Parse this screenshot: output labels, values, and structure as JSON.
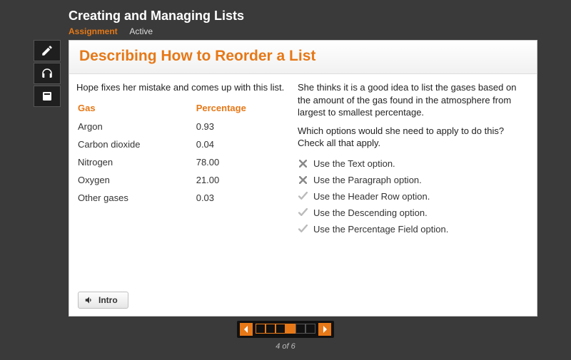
{
  "header": {
    "title": "Creating and Managing Lists",
    "assignment_label": "Assignment",
    "status_label": "Active"
  },
  "panel": {
    "title": "Describing How to Reorder a List",
    "left_intro": "Hope fixes her mistake and comes up with this list.",
    "table_headers": {
      "gas": "Gas",
      "percentage": "Percentage"
    },
    "gases": [
      {
        "name": "Argon",
        "pct": "0.93"
      },
      {
        "name": "Carbon dioxide",
        "pct": "0.04"
      },
      {
        "name": "Nitrogen",
        "pct": "78.00"
      },
      {
        "name": "Oxygen",
        "pct": "21.00"
      },
      {
        "name": "Other gases",
        "pct": "0.03"
      }
    ],
    "right_think1": "She thinks it is a good idea to list the gases based on the amount of the gas found in the atmosphere from largest to smallest percentage.",
    "right_think2": "Which options would she need to apply to do this? Check all that apply.",
    "options": [
      {
        "text": "Use the Text option.",
        "state": "x"
      },
      {
        "text": "Use the Paragraph option.",
        "state": "x"
      },
      {
        "text": "Use the Header Row option.",
        "state": "check"
      },
      {
        "text": "Use the Descending option.",
        "state": "check"
      },
      {
        "text": "Use the Percentage Field option.",
        "state": "check"
      }
    ],
    "intro_button": "Intro"
  },
  "pager": {
    "current": 4,
    "total": 6,
    "label": "4 of 6"
  }
}
